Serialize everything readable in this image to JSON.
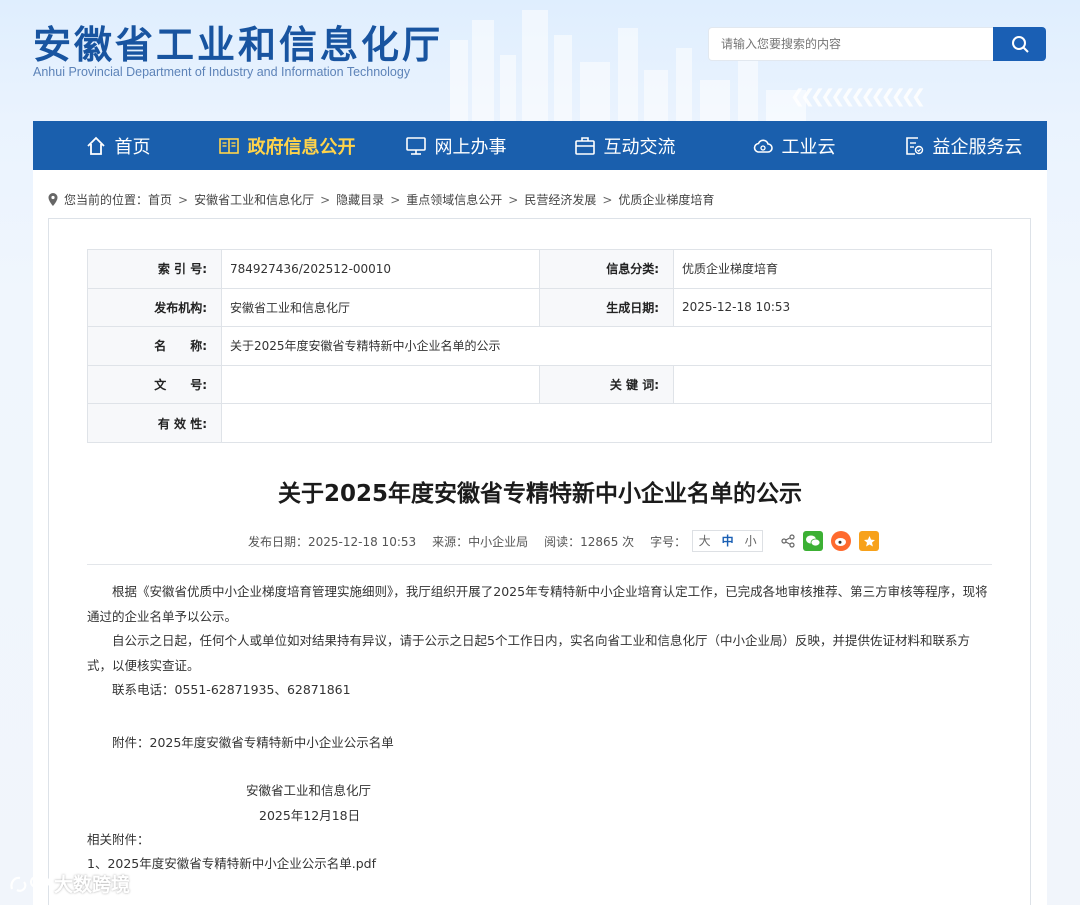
{
  "header": {
    "title": "安徽省工业和信息化厅",
    "subtitle": "Anhui Provincial Department of Industry and Information Technology",
    "search_placeholder": "请输入您要搜索的内容"
  },
  "nav": [
    {
      "label": "首页",
      "icon": "home-icon"
    },
    {
      "label": "政府信息公开",
      "icon": "book-icon",
      "active": true
    },
    {
      "label": "网上办事",
      "icon": "monitor-icon"
    },
    {
      "label": "互动交流",
      "icon": "briefcase-icon"
    },
    {
      "label": "工业云",
      "icon": "cloud-icon"
    },
    {
      "label": "益企服务云",
      "icon": "document-check-icon"
    }
  ],
  "breadcrumb": {
    "prefix": "您当前的位置：",
    "items": [
      "首页",
      "安徽省工业和信息化厅",
      "隐藏目录",
      "重点领域信息公开",
      "民营经济发展",
      "优质企业梯度培育"
    ]
  },
  "meta": {
    "index_label": "索 引 号:",
    "index_value": "784927436/202512-00010",
    "category_label": "信息分类:",
    "category_value": "优质企业梯度培育",
    "publisher_label": "发布机构:",
    "publisher_value": "安徽省工业和信息化厅",
    "date_label": "生成日期:",
    "date_value": "2025-12-18 10:53",
    "name_label": "名　　称:",
    "name_value": "关于2025年度安徽省专精特新中小企业名单的公示",
    "docno_label": "文　　号:",
    "docno_value": "",
    "keywords_label": "关 键 词:",
    "keywords_value": "",
    "validity_label": "有 效 性:",
    "validity_value": ""
  },
  "article": {
    "title": "关于2025年度安徽省专精特新中小企业名单的公示",
    "publish_date": "发布日期：2025-12-18 10:53",
    "source": "来源：中小企业局",
    "reads": "阅读：12865 次",
    "font_size_label": "字号：",
    "font_sizes": [
      "大",
      "中",
      "小"
    ],
    "para1": "根据《安徽省优质中小企业梯度培育管理实施细则》，我厅组织开展了2025年专精特新中小企业培育认定工作，已完成各地审核推荐、第三方审核等程序，现将通过的企业名单予以公示。",
    "para2": "自公示之日起，任何个人或单位如对结果持有异议，请于公示之日起5个工作日内，实名向省工业和信息化厅（中小企业局）反映，并提供佐证材料和联系方式，以便核实查证。",
    "contact": "联系电话：0551-62871935、62871861",
    "attachment_line": "附件：2025年度安徽省专精特新中小企业公示名单",
    "signature_org": "安徽省工业和信息化厅",
    "signature_date": "2025年12月18日",
    "related_label": "相关附件：",
    "related_file": "1、2025年度安徽省专精特新中小企业公示名单.pdf"
  },
  "watermark": "大数跨境",
  "colors": {
    "nav_bg": "#1a5fad",
    "active_nav": "#ffd34a",
    "title_blue": "#1854a0"
  }
}
